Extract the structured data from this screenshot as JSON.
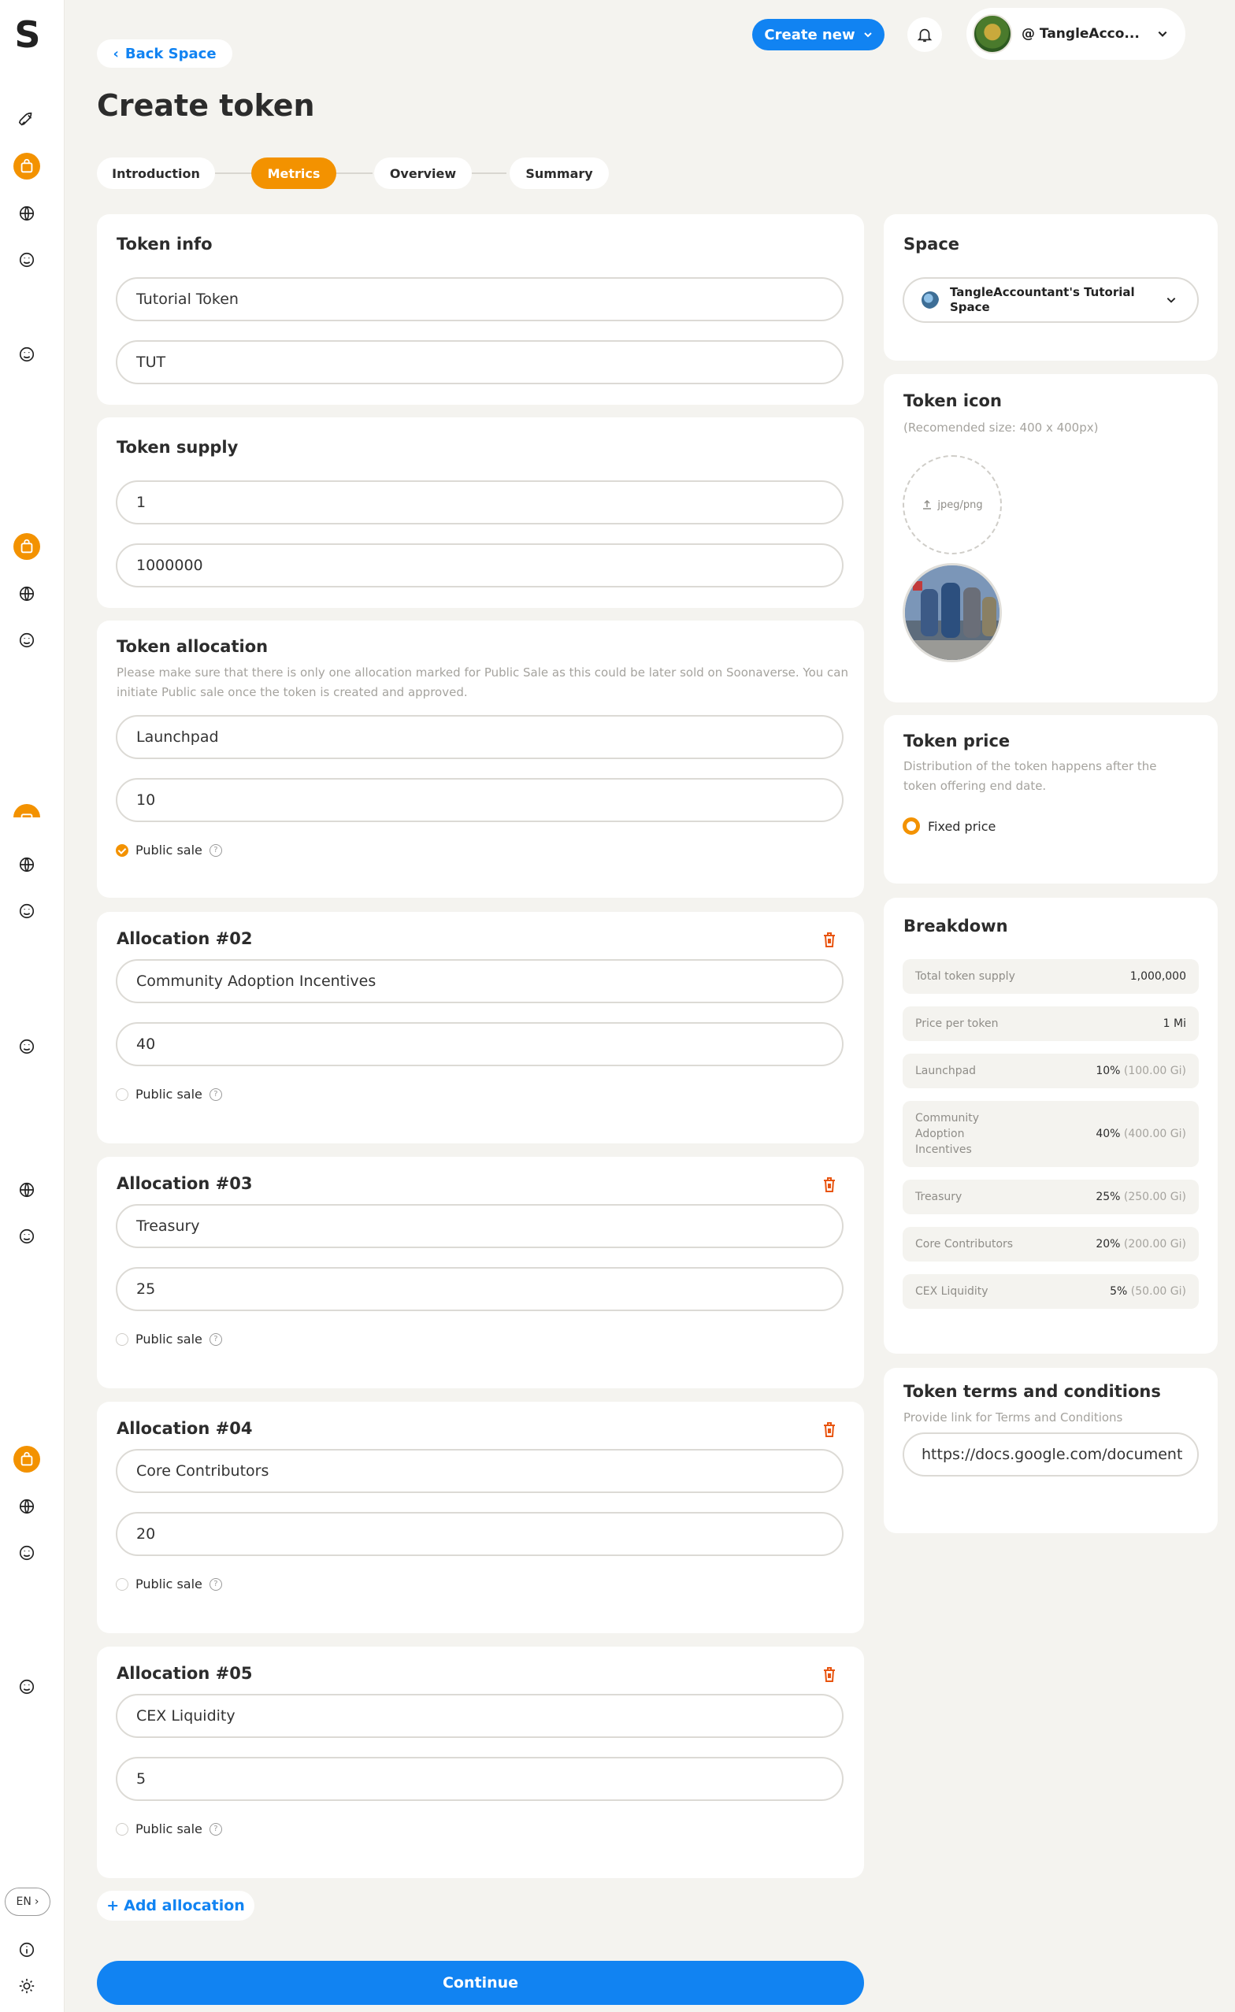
{
  "sidebar": {
    "logo": "S",
    "language": "EN"
  },
  "topbar": {
    "create_new_label": "Create new",
    "user_name": "@ TangleAcco..."
  },
  "nav": {
    "back_label": "Back Space"
  },
  "page_title": "Create token",
  "steps": [
    {
      "label": "Introduction",
      "active": false
    },
    {
      "label": "Metrics",
      "active": true
    },
    {
      "label": "Overview",
      "active": false
    },
    {
      "label": "Summary",
      "active": false
    }
  ],
  "token_info": {
    "title": "Token info",
    "name_value": "Tutorial Token",
    "symbol_value": "TUT"
  },
  "token_supply": {
    "title": "Token supply",
    "price_value": "1",
    "supply_value": "1000000"
  },
  "token_allocation": {
    "title": "Token allocation",
    "description": "Please make sure that there is only one allocation marked for Public Sale as this could be later sold on Soonaverse. You can initiate Public sale once the token is created and approved.",
    "public_sale_label": "Public sale",
    "allocations": [
      {
        "title": "",
        "name": "Launchpad",
        "percentage": "10",
        "public_sale": true
      },
      {
        "title": "Allocation #02",
        "name": "Community Adoption Incentives",
        "percentage": "40",
        "public_sale": false
      },
      {
        "title": "Allocation #03",
        "name": "Treasury",
        "percentage": "25",
        "public_sale": false
      },
      {
        "title": "Allocation #04",
        "name": "Core Contributors",
        "percentage": "20",
        "public_sale": false
      },
      {
        "title": "Allocation #05",
        "name": "CEX Liquidity",
        "percentage": "5",
        "public_sale": false
      }
    ],
    "add_label": "Add allocation"
  },
  "continue_label": "Continue",
  "space": {
    "title": "Space",
    "selected": "TangleAccountant's Tutorial Space"
  },
  "token_icon": {
    "title": "Token icon",
    "hint": "(Recomended size: 400 x 400px)",
    "upload_label": "jpeg/png"
  },
  "token_price": {
    "title": "Token price",
    "description": "Distribution of the token happens after the token offering end date.",
    "option_label": "Fixed price"
  },
  "breakdown": {
    "title": "Breakdown",
    "rows": [
      {
        "label": "Total token supply",
        "value": "1,000,000",
        "extra": ""
      },
      {
        "label": "Price per token",
        "value": "1 Mi",
        "extra": ""
      },
      {
        "label": "Launchpad",
        "value": "10%",
        "extra": "(100.00 Gi)"
      },
      {
        "label": "Community Adoption Incentives",
        "value": "40%",
        "extra": "(400.00 Gi)"
      },
      {
        "label": "Treasury",
        "value": "25%",
        "extra": "(250.00 Gi)"
      },
      {
        "label": "Core Contributors",
        "value": "20%",
        "extra": "(200.00 Gi)"
      },
      {
        "label": "CEX Liquidity",
        "value": "5%",
        "extra": "(50.00 Gi)"
      }
    ]
  },
  "terms": {
    "title": "Token terms and conditions",
    "description": "Provide link for Terms and Conditions",
    "link_value": "https://docs.google.com/document"
  },
  "colors": {
    "accent_orange": "#f39200",
    "primary_blue": "#1183f2",
    "danger_red": "#e8540f"
  }
}
